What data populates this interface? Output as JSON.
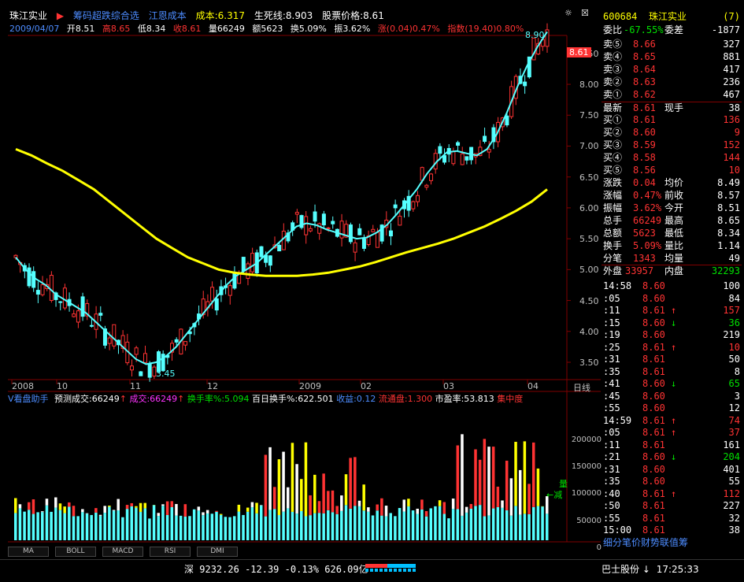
{
  "header": {
    "stock_name": "珠江实业",
    "indicator1": "筹码超跌综合选",
    "indicator2": "江恩成本",
    "cost_label": "成本:6.317",
    "life_line": "生死线:8.903",
    "stock_price": "股票价格:8.61"
  },
  "info_line": {
    "date": "2009/04/07",
    "open": "开8.51",
    "high": "高8.65",
    "low": "低8.34",
    "close": "收8.61",
    "volume": "量66249",
    "amount": "额5623",
    "turnover": "换5.09%",
    "amplitude": "振3.62%",
    "change": "涨(0.04)0.47%",
    "index": "指数(19.40)0.80%"
  },
  "price_axis": [
    "8.50",
    "8.00",
    "7.50",
    "7.00",
    "6.50",
    "6.00",
    "5.50",
    "5.00",
    "4.50",
    "4.00",
    "3.50"
  ],
  "price_marker": "8.61",
  "peak_label": "8.90",
  "low_label": "3.45",
  "time_axis": [
    "2008",
    "10",
    "11",
    "12",
    "2009",
    "02",
    "03",
    "04"
  ],
  "time_axis_right": "日线",
  "volume_panel": {
    "title": "V看盘助手",
    "forecast": "预测成交:66249",
    "deal": "成交:66249",
    "turnover_rate": "换手率%:5.094",
    "turnover_100": "百日换手%:622.501",
    "revenue": "收益:0.12",
    "float_shares": "流通盘:1.300",
    "pe": "市盈率:53.813",
    "conc": "集中度",
    "axis": [
      "200000",
      "150000",
      "100000",
      "50000",
      "0"
    ],
    "annot1": "量",
    "annot2": "←减"
  },
  "right_panel": {
    "code": "600684",
    "name": "珠江实业",
    "num": "7",
    "weibi_label": "委比",
    "weibi": "-67.55%",
    "weicha_label": "委差",
    "weicha": "-1877",
    "sells": [
      {
        "label": "卖⑤",
        "price": "8.66",
        "vol": "327"
      },
      {
        "label": "卖④",
        "price": "8.65",
        "vol": "881"
      },
      {
        "label": "卖③",
        "price": "8.64",
        "vol": "417"
      },
      {
        "label": "卖②",
        "price": "8.63",
        "vol": "236"
      },
      {
        "label": "卖①",
        "price": "8.62",
        "vol": "467"
      }
    ],
    "latest_label": "最新",
    "latest": "8.61",
    "xianshou_label": "现手",
    "xianshou": "38",
    "buys": [
      {
        "label": "买①",
        "price": "8.61",
        "vol": "136"
      },
      {
        "label": "买②",
        "price": "8.60",
        "vol": "9"
      },
      {
        "label": "买③",
        "price": "8.59",
        "vol": "152"
      },
      {
        "label": "买④",
        "price": "8.58",
        "vol": "144"
      },
      {
        "label": "买⑤",
        "price": "8.56",
        "vol": "10"
      }
    ],
    "stats": [
      {
        "l1": "涨跌",
        "v1": "0.04",
        "l2": "均价",
        "v2": "8.49"
      },
      {
        "l1": "涨幅",
        "v1": "0.47%",
        "l2": "前收",
        "v2": "8.57"
      },
      {
        "l1": "振幅",
        "v1": "3.62%",
        "l2": "今开",
        "v2": "8.51"
      },
      {
        "l1": "总手",
        "v1": "66249",
        "l2": "最高",
        "v2": "8.65"
      },
      {
        "l1": "总额",
        "v1": "5623",
        "l2": "最低",
        "v2": "8.34"
      },
      {
        "l1": "换手",
        "v1": "5.09%",
        "l2": "量比",
        "v2": "1.14"
      },
      {
        "l1": "分笔",
        "v1": "1343",
        "l2": "均量",
        "v2": "49"
      }
    ],
    "outer_label": "外盘",
    "outer": "33957",
    "inner_label": "内盘",
    "inner": "32293",
    "ticks": [
      {
        "t": "14:58",
        "p": "8.60",
        "d": "",
        "v": "100"
      },
      {
        "t": ":05",
        "p": "8.60",
        "d": "",
        "v": "84"
      },
      {
        "t": ":11",
        "p": "8.61",
        "d": "↑",
        "v": "157"
      },
      {
        "t": ":15",
        "p": "8.60",
        "d": "↓",
        "v": "36"
      },
      {
        "t": ":19",
        "p": "8.60",
        "d": "",
        "v": "219"
      },
      {
        "t": ":25",
        "p": "8.61",
        "d": "↑",
        "v": "10"
      },
      {
        "t": ":31",
        "p": "8.61",
        "d": "",
        "v": "50"
      },
      {
        "t": ":35",
        "p": "8.61",
        "d": "",
        "v": "8"
      },
      {
        "t": ":41",
        "p": "8.60",
        "d": "↓",
        "v": "65"
      },
      {
        "t": ":45",
        "p": "8.60",
        "d": "",
        "v": "3"
      },
      {
        "t": ":55",
        "p": "8.60",
        "d": "",
        "v": "12"
      },
      {
        "t": "14:59",
        "p": "8.61",
        "d": "↑",
        "v": "74"
      },
      {
        "t": ":05",
        "p": "8.61",
        "d": "↑",
        "v": "37"
      },
      {
        "t": ":11",
        "p": "8.61",
        "d": "",
        "v": "161"
      },
      {
        "t": ":21",
        "p": "8.60",
        "d": "↓",
        "v": "204"
      },
      {
        "t": ":31",
        "p": "8.60",
        "d": "",
        "v": "401"
      },
      {
        "t": ":35",
        "p": "8.60",
        "d": "",
        "v": "55"
      },
      {
        "t": ":40",
        "p": "8.61",
        "d": "↑",
        "v": "112"
      },
      {
        "t": ":50",
        "p": "8.61",
        "d": "",
        "v": "227"
      },
      {
        "t": ":55",
        "p": "8.61",
        "d": "",
        "v": "32"
      },
      {
        "t": "15:00",
        "p": "8.61",
        "d": "",
        "v": "38"
      }
    ],
    "bottom_tabs": "细分笔价财势联值筹"
  },
  "tabs": [
    "MA",
    "BOLL",
    "MACD",
    "RSI",
    "DMI"
  ],
  "status": {
    "market": "深",
    "index": "9232.26",
    "change": "-12.39",
    "pct": "-0.13%",
    "amount": "626.09亿",
    "ticker": "巴士股份",
    "time": "17:25:33"
  },
  "chart_data": {
    "type": "candlestick",
    "ylim": [
      3.2,
      9.1
    ],
    "ma_cyan": [
      5.2,
      5.0,
      4.85,
      4.75,
      4.6,
      4.5,
      4.4,
      4.3,
      4.15,
      4.0,
      3.85,
      3.7,
      3.55,
      3.47,
      3.5,
      3.6,
      3.75,
      3.95,
      4.15,
      4.35,
      4.55,
      4.75,
      4.9,
      5.0,
      5.1,
      5.25,
      5.4,
      5.55,
      5.7,
      5.75,
      5.72,
      5.65,
      5.6,
      5.55,
      5.5,
      5.52,
      5.6,
      5.72,
      5.9,
      6.1,
      6.3,
      6.55,
      6.75,
      6.9,
      6.92,
      6.88,
      6.85,
      6.95,
      7.2,
      7.55,
      7.95,
      8.3,
      8.6,
      8.85
    ],
    "ma_yellow": [
      6.95,
      6.85,
      6.72,
      6.6,
      6.45,
      6.3,
      6.1,
      5.9,
      5.7,
      5.5,
      5.35,
      5.2,
      5.1,
      5.0,
      4.95,
      4.92,
      4.9,
      4.9,
      4.9,
      4.92,
      4.95,
      5.0,
      5.05,
      5.12,
      5.2,
      5.28,
      5.35,
      5.42,
      5.5,
      5.6,
      5.7,
      5.82,
      5.95,
      6.1,
      6.3
    ],
    "volume_max": 220000
  }
}
